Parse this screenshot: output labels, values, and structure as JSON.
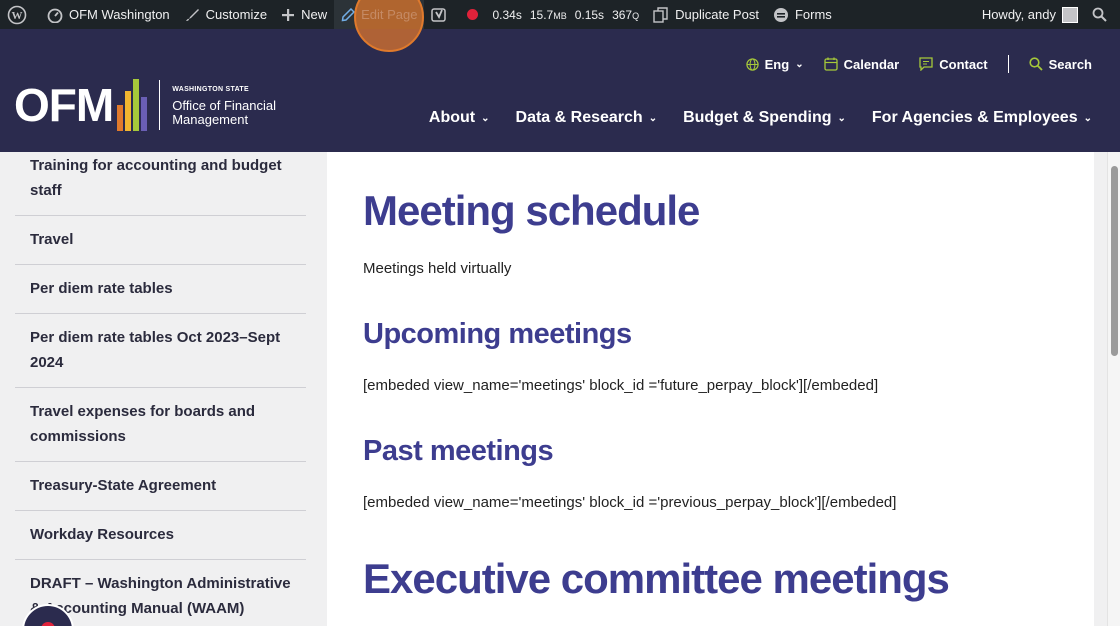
{
  "adminbar": {
    "site_name": "OFM Washington",
    "customize": "Customize",
    "new": "New",
    "edit_page": "Edit Page",
    "metrics": {
      "time1": "0.34s",
      "memory": "15.7",
      "memory_unit": "MB",
      "time2": "0.15s",
      "queries": "367",
      "queries_unit": "Q"
    },
    "duplicate": "Duplicate Post",
    "forms": "Forms",
    "howdy": "Howdy, andy"
  },
  "header": {
    "logo_text": "OFM",
    "logo_state": "WASHINGTON STATE",
    "logo_line1": "Office of Financial",
    "logo_line2": "Management",
    "util": {
      "lang": "Eng",
      "calendar": "Calendar",
      "contact": "Contact",
      "search": "Search"
    },
    "nav": [
      "About",
      "Data & Research",
      "Budget & Spending",
      "For Agencies & Employees"
    ]
  },
  "sidebar": {
    "items": [
      "Training for accounting and budget staff",
      "Travel",
      "Per diem rate tables",
      "Per diem rate tables Oct 2023–Sept 2024",
      "Travel expenses for boards and commissions",
      "Treasury-State Agreement",
      "Workday Resources",
      "DRAFT – Washington Administrative & Accounting Manual (WAAM)"
    ]
  },
  "main": {
    "title": "Meeting schedule",
    "intro": "Meetings held virtually",
    "upcoming_heading": "Upcoming meetings",
    "upcoming_shortcode": "[embeded view_name='meetings' block_id ='future_perpay_block'][/embeded]",
    "past_heading": "Past meetings",
    "past_shortcode": "[embeded view_name='meetings' block_id ='previous_perpay_block'][/embeded]",
    "exec_heading": "Executive committee meetings"
  },
  "colors": {
    "header_bg": "#2b2b4e",
    "heading": "#3d3d8f",
    "accent_green": "#a6c93a",
    "admin_bg": "#1d2327"
  }
}
